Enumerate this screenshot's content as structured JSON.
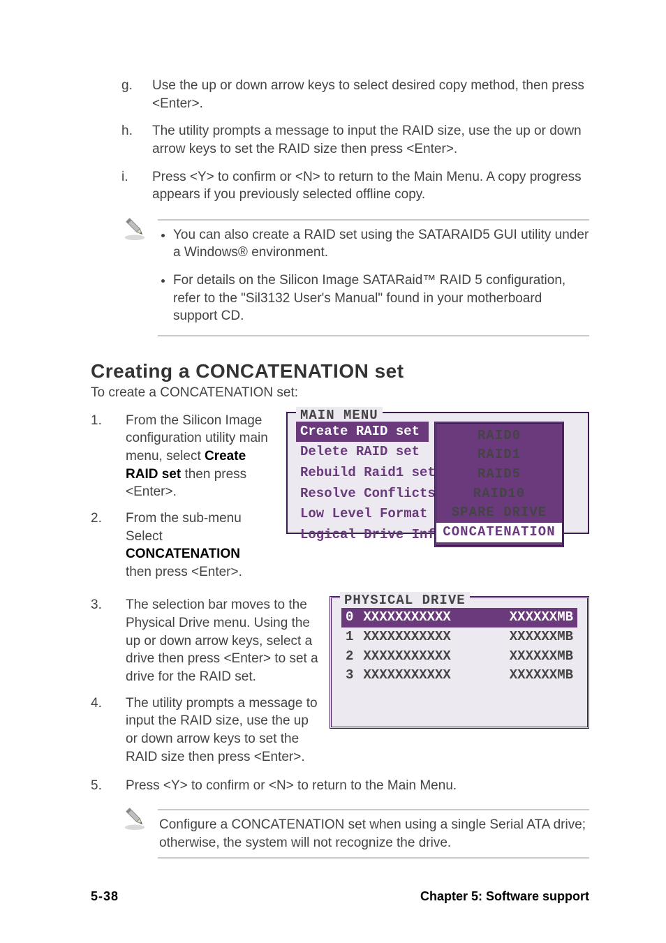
{
  "letters": {
    "g": {
      "marker": "g.",
      "text": "Use the up or down arrow keys to select desired copy method, then press <Enter>."
    },
    "h": {
      "marker": "h.",
      "text": "The utility prompts a message to input the RAID size, use the up or down arrow keys to set the RAID size then press <Enter>."
    },
    "i": {
      "marker": "i.",
      "text": "Press <Y> to confirm or <N> to return to the Main Menu. A copy progress appears if you previously selected offline copy."
    }
  },
  "note1": {
    "items": [
      "You can also create a RAID set using the SATARAID5 GUI utility under a Windows® environment.",
      "For details on the Silicon Image SATARaid™ RAID 5 configuration, refer to the \"Sil3132 User's Manual\" found in your motherboard support CD."
    ]
  },
  "section": {
    "title": "Creating a CONCATENATION set",
    "subtitle": "To create a CONCATENATION set:"
  },
  "steps": {
    "s1": {
      "marker": "1.",
      "pre": "From the Silicon Image configuration utility main menu, select ",
      "strong": "Create RAID set",
      "post": " then press <Enter>."
    },
    "s2": {
      "marker": "2.",
      "pre": "From the sub-menu Select ",
      "strong": "CONCATENATION",
      "post": " then press <Enter>."
    },
    "s3": {
      "marker": "3.",
      "text": "The selection bar moves to the Physical Drive menu. Using the up or down arrow keys, select a drive then press <Enter> to set a drive for the RAID set."
    },
    "s4": {
      "marker": "4.",
      "text": "The utility prompts a message to input the RAID size, use the up or down arrow keys to set the RAID size then press <Enter>."
    },
    "s5": {
      "marker": "5.",
      "text": "Press <Y> to confirm or <N> to return to the Main Menu."
    }
  },
  "bios_main": {
    "legend": "MAIN MENU",
    "menu": [
      {
        "label": "Create RAID set",
        "selected": true
      },
      {
        "label": "Delete RAID set",
        "selected": false
      },
      {
        "label": "Rebuild Raid1 set",
        "selected": false
      },
      {
        "label": "Resolve Conflicts",
        "selected": false
      },
      {
        "label": "Low Level Format",
        "selected": false
      },
      {
        "label": "Logical Drive Info",
        "selected": false
      }
    ],
    "popup": [
      {
        "label": "RAID0",
        "selected": false
      },
      {
        "label": "RAID1",
        "selected": false
      },
      {
        "label": "RAID5",
        "selected": false
      },
      {
        "label": "RAID10",
        "selected": false
      },
      {
        "label": "SPARE DRIVE",
        "selected": false
      },
      {
        "label": "CONCATENATION",
        "selected": true
      }
    ]
  },
  "bios_phys": {
    "legend": "PHYSICAL DRIVE",
    "rows": [
      {
        "idx": "0",
        "name": "XXXXXXXXXXX",
        "size": "XXXXXXMB",
        "selected": true
      },
      {
        "idx": "1",
        "name": "XXXXXXXXXXX",
        "size": "XXXXXXMB",
        "selected": false
      },
      {
        "idx": "2",
        "name": "XXXXXXXXXXX",
        "size": "XXXXXXMB",
        "selected": false
      },
      {
        "idx": "3",
        "name": "XXXXXXXXXXX",
        "size": "XXXXXXMB",
        "selected": false
      }
    ]
  },
  "note2": {
    "text": "Configure a CONCATENATION set when using a single Serial ATA drive; otherwise, the system will not recognize the drive."
  },
  "footer": {
    "page": "5-38",
    "chapter_prefix": "Chapter 5: Soft",
    "chapter_suffix": "ware support"
  }
}
